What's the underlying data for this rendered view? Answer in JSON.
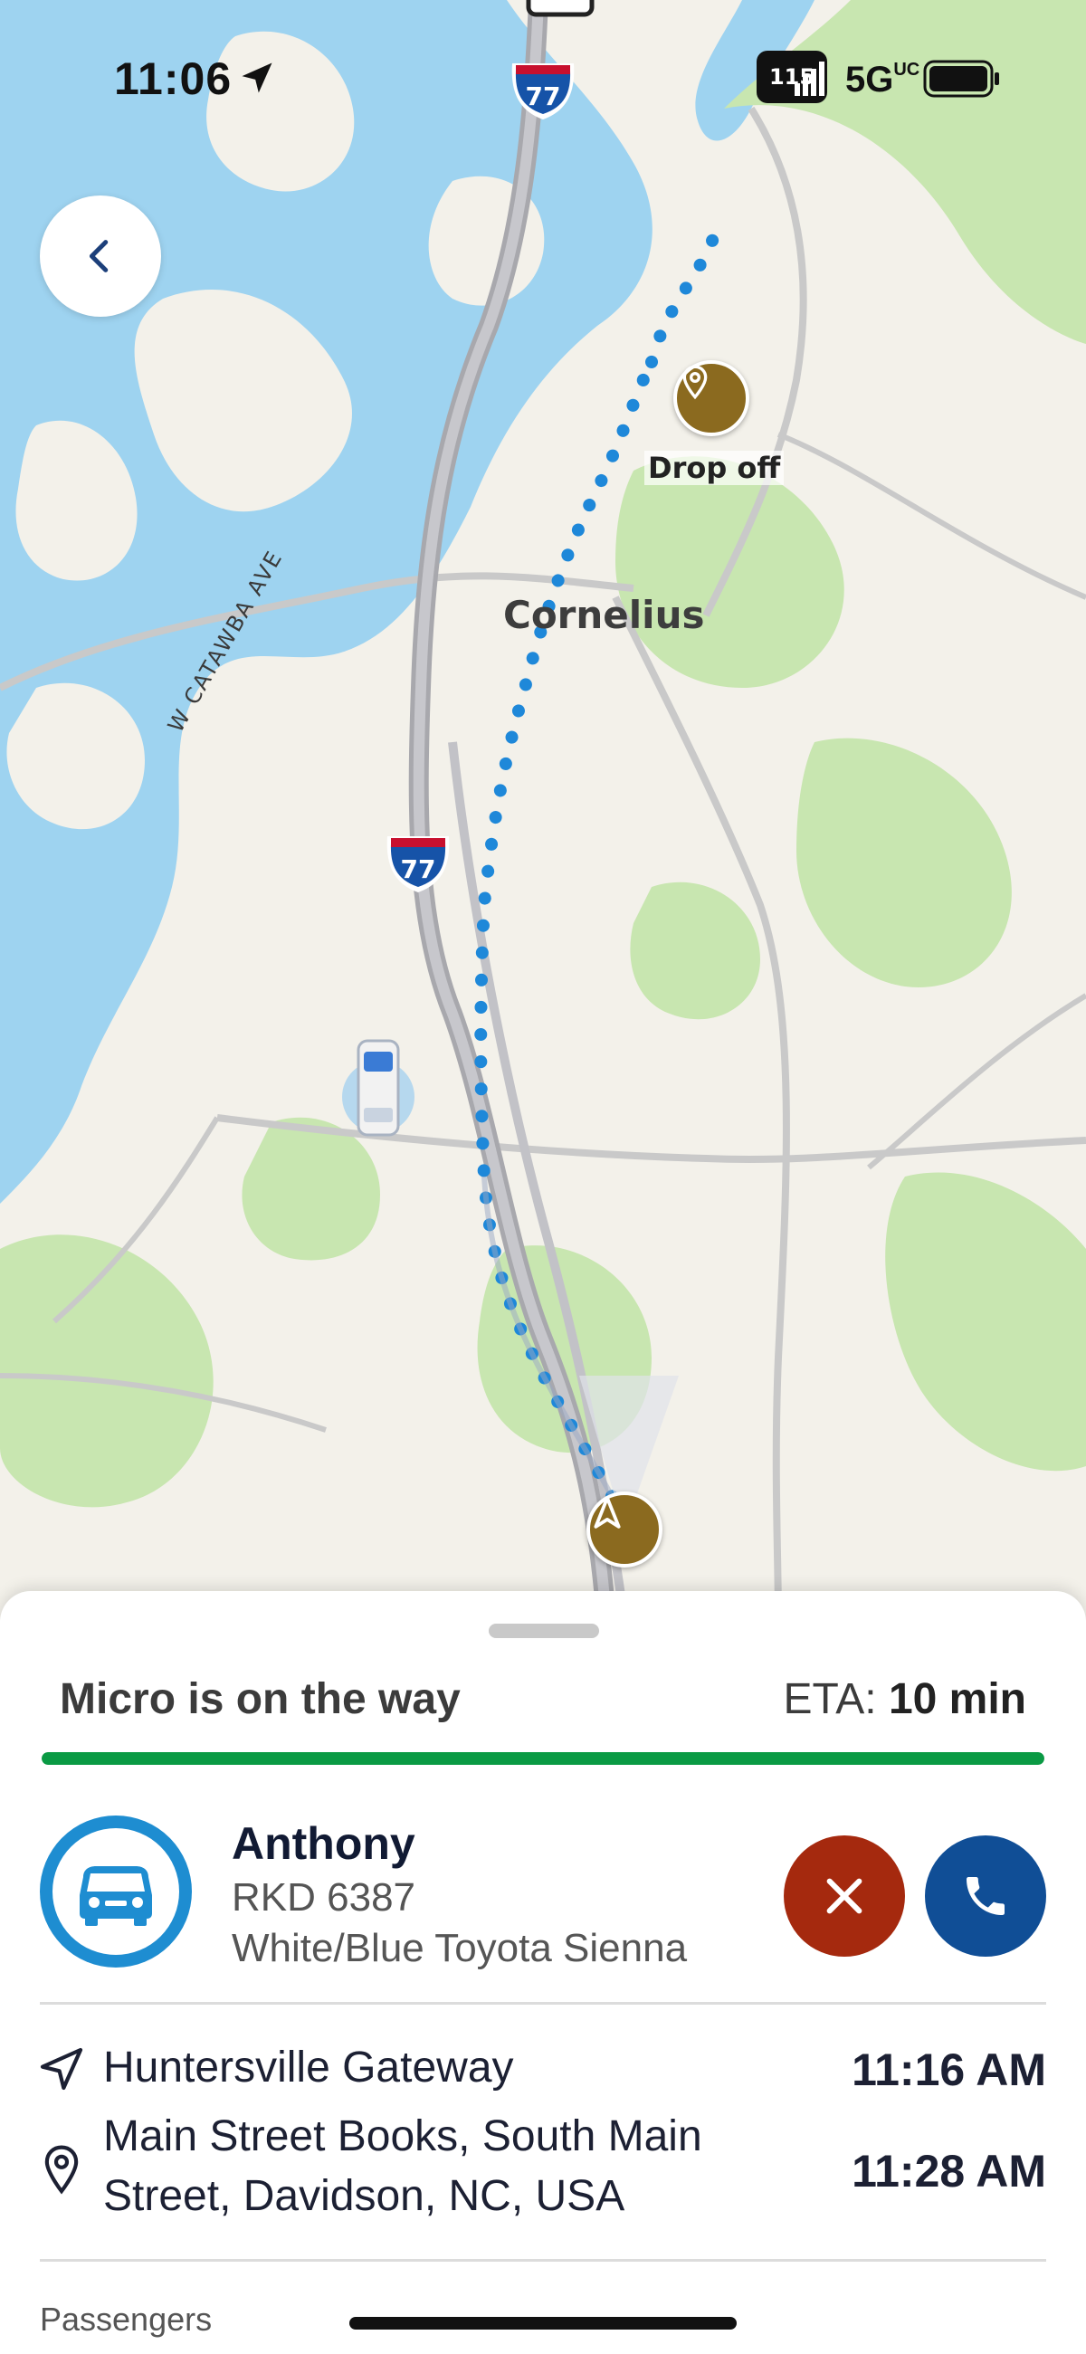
{
  "status_bar": {
    "time": "11:06",
    "network": "5G",
    "network_suffix": "UC",
    "signal_badge": "115"
  },
  "map": {
    "place_label": "Cornelius",
    "road_label": "W CATAWBA AVE",
    "dropoff_label": "Drop off",
    "highway_number": "77",
    "colors": {
      "water": "#9ed3f0",
      "land": "#f3f1ea",
      "park": "#c8e6b0",
      "route_dots": "#1e88d9",
      "pin": "#8b6a1f"
    }
  },
  "trip": {
    "status": "Micro is on the way",
    "eta_label": "ETA:",
    "eta_value": "10 min",
    "progress": 1.0,
    "progress_color": "#0a9a44"
  },
  "driver": {
    "name": "Anthony",
    "plate": "RKD 6387",
    "vehicle": "White/Blue Toyota Sienna",
    "icon": "van-icon"
  },
  "stops": [
    {
      "name": "Huntersville Gateway",
      "time": "11:16 AM",
      "icon": "navigation-arrow-icon"
    },
    {
      "name": "Main Street Books, South Main Street, Davidson, NC, USA",
      "time": "11:28 AM",
      "icon": "location-pin-icon"
    }
  ],
  "passengers": {
    "label": "Passengers"
  }
}
